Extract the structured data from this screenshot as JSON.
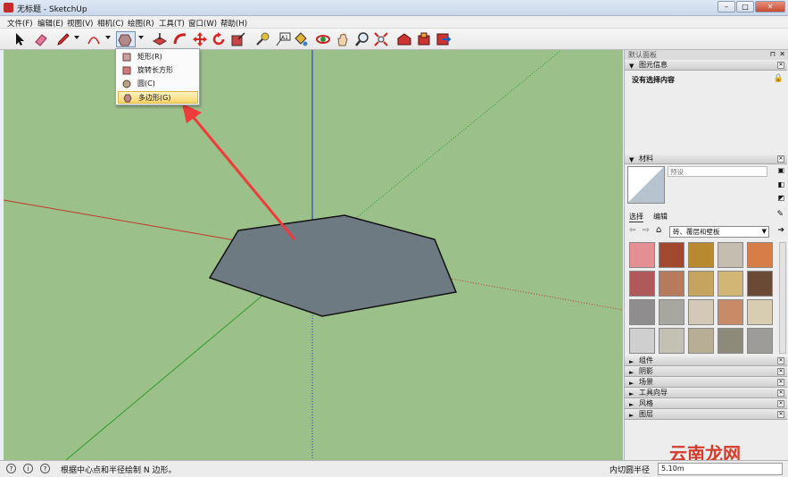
{
  "window": {
    "title": "无标题 - SketchUp",
    "buttons": [
      "–",
      "□",
      "✕"
    ]
  },
  "menu": [
    "文件(F)",
    "编辑(E)",
    "视图(V)",
    "相机(C)",
    "绘图(R)",
    "工具(T)",
    "窗口(W)",
    "帮助(H)"
  ],
  "toolbar": {
    "icons": [
      "select-icon",
      "eraser-icon",
      "pencil-icon",
      "arc-icon",
      "shapes-icon",
      "push-pull-icon",
      "follow-me-icon",
      "move-icon",
      "rotate-icon",
      "scale-icon",
      "tape-measure-icon",
      "text-icon",
      "paint-bucket-icon",
      "orbit-icon",
      "pan-icon",
      "zoom-icon",
      "zoom-extents-icon",
      "warehouse-icon",
      "components-icon",
      "share-icon"
    ]
  },
  "shapes_dropdown": {
    "items": [
      {
        "label": "矩形(R)",
        "icon": "rectangle-icon",
        "selected": false
      },
      {
        "label": "旋转长方形",
        "icon": "rotated-rectangle-icon",
        "selected": false
      },
      {
        "label": "圆(C)",
        "icon": "circle-icon",
        "selected": false
      },
      {
        "label": "多边形(G)",
        "icon": "polygon-icon",
        "selected": true
      }
    ]
  },
  "tray": {
    "title": "默认面板",
    "entity_info": {
      "header": "图元信息",
      "content": "没有选择内容"
    },
    "materials": {
      "header": "材料",
      "name_placeholder": "",
      "name_value": "预设",
      "tabs": [
        "选择",
        "编辑"
      ],
      "library": "砖、覆层和壁板"
    },
    "collapsed_sections": [
      "组件",
      "阴影",
      "场景",
      "工具向导",
      "风格",
      "图层"
    ]
  },
  "status": {
    "hint": "根据中心点和半径绘制 N 边形。",
    "measure_label": "内切圆半径",
    "measure_value": "5.10m"
  },
  "watermark": "云南龙网",
  "colors": {
    "viewport": "#9cc08a",
    "face": "#6e7a82",
    "axis_red": "#c0392b",
    "axis_green": "#2e9b2e",
    "axis_blue": "#1f2ec8",
    "arrow": "#ee3b3b"
  }
}
